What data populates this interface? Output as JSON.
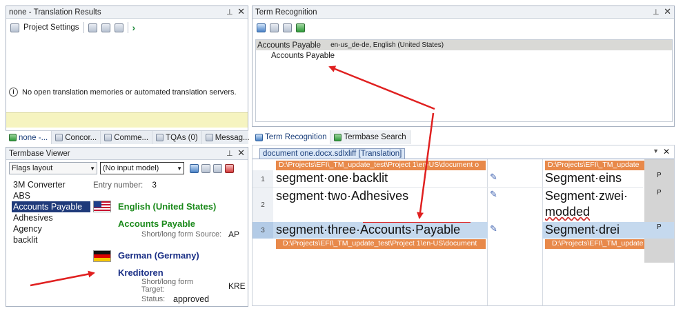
{
  "translation_results": {
    "title": "none - Translation Results",
    "project_settings_label": "Project Settings",
    "message": "No open translation memories or automated translation servers."
  },
  "bottom_tabs": [
    {
      "label": "none -..."
    },
    {
      "label": "Concor..."
    },
    {
      "label": "Comme..."
    },
    {
      "label": "TQAs (0)"
    },
    {
      "label": "Messag..."
    }
  ],
  "termbase_viewer": {
    "title": "Termbase Viewer",
    "layout_select": "Flags layout",
    "model_select": "(No input model)",
    "terms": [
      "3M Converter",
      "ABS",
      "Accounts Payable",
      "Adhesives",
      "Agency",
      "backlit"
    ],
    "selected_term_index": 2,
    "entry_number_label": "Entry number:",
    "entry_number": "3",
    "lang1": "English (United States)",
    "lang1_term": "Accounts Payable",
    "lang1_field_label": "Short/long form Source:",
    "lang1_field_value": "AP",
    "lang2": "German (Germany)",
    "lang2_term": "Kreditoren",
    "lang2_field_label": "Short/long form Target:",
    "lang2_field_value": "KRE",
    "status_label": "Status:",
    "status_value": "approved"
  },
  "term_recognition": {
    "title": "Term Recognition",
    "header_term": "Accounts Payable",
    "header_langs": "en-us_de-de, English (United States)",
    "result_term": "Accounts Payable",
    "tabs": [
      {
        "label": "Term Recognition"
      },
      {
        "label": "Termbase Search"
      }
    ]
  },
  "editor": {
    "doc_tab": "document one.docx.sdlxliff [Translation]",
    "path_src": "D:\\Projects\\EFI\\_TM_update_test\\Project 1\\en-US\\document o",
    "path_tgt": "D:\\Projects\\EFI\\_TM_update",
    "path_src_bottom": "D:\\Projects\\EFI\\_TM_update_test\\Project 1\\en-US\\document",
    "path_tgt_bottom": "D:\\Projects\\EFI\\_TM_update",
    "segments": [
      {
        "num": "1",
        "source": "segment·one·backlit",
        "target": "Segment·eins",
        "status": "P"
      },
      {
        "num": "2",
        "source": "segment·two·Adhesives",
        "target": "Segment·zwei·",
        "target2": "modded",
        "status": "P"
      },
      {
        "num": "3",
        "source": "segment·three·Accounts·Payable",
        "target": "Segment·drei",
        "status": "P"
      }
    ]
  },
  "colors": {
    "path_tag": "#e8894a",
    "active_row": "#c5d9ee",
    "selected_term": "#1f3a7a",
    "english_green": "#1b8a1b",
    "german_blue": "#1a2f86",
    "arrow": "#e02020"
  }
}
